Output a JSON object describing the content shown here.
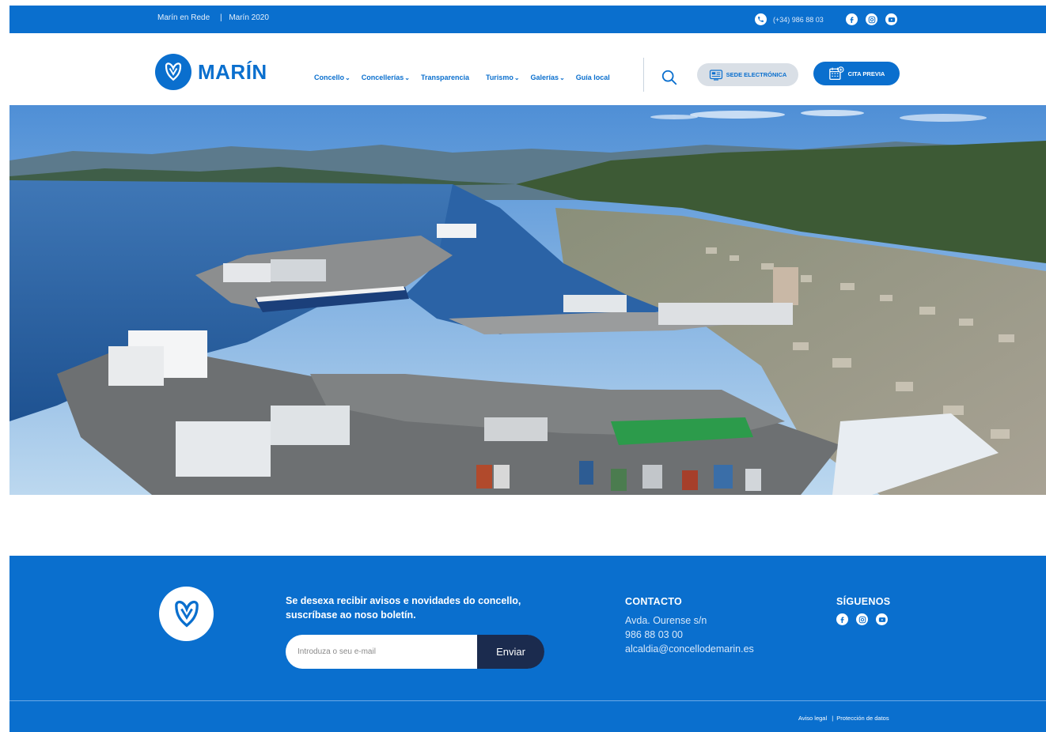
{
  "topbar": {
    "link1": "Marín en Rede",
    "sep": "|",
    "link2": "Marín 2020",
    "phone": "(+34) 986 88 03",
    "social_icons": [
      "facebook-icon",
      "instagram-icon",
      "youtube-icon"
    ]
  },
  "header": {
    "logo_text": "MARÍN",
    "nav": [
      {
        "label": "Concello",
        "dropdown": true
      },
      {
        "label": "Concellerías",
        "dropdown": true
      },
      {
        "label": "Transparencia",
        "dropdown": false
      },
      {
        "label": "Turismo",
        "dropdown": true
      },
      {
        "label": "Galerías",
        "dropdown": true
      },
      {
        "label": "Guía local",
        "dropdown": false
      }
    ],
    "search_icon": "search-icon",
    "sede_label": "SEDE ELECTRÓNICA",
    "cita_label": "CITA PREVIA"
  },
  "hero": {
    "image": "aerial-photo-port-of-marin"
  },
  "footer": {
    "newsletter_text": "Se desexa recibir avisos e novidades do concello, suscríbase ao noso boletín.",
    "email_placeholder": "Introduza o seu e-mail",
    "submit_label": "Enviar",
    "contact_title": "CONTACTO",
    "contact_address": "Avda. Ourense s/n",
    "contact_phone": "986 88 03 00",
    "contact_email": "alcaldia@concellodemarin.es",
    "follow_title": "SÍGUENOS",
    "legal_link1": "Aviso legal",
    "legal_sep": "|",
    "legal_link2": "Protección de datos"
  },
  "colors": {
    "brand_blue": "#0a6fce",
    "dark_navy": "#1b2b4e",
    "sede_bg": "#d9dfe6"
  }
}
